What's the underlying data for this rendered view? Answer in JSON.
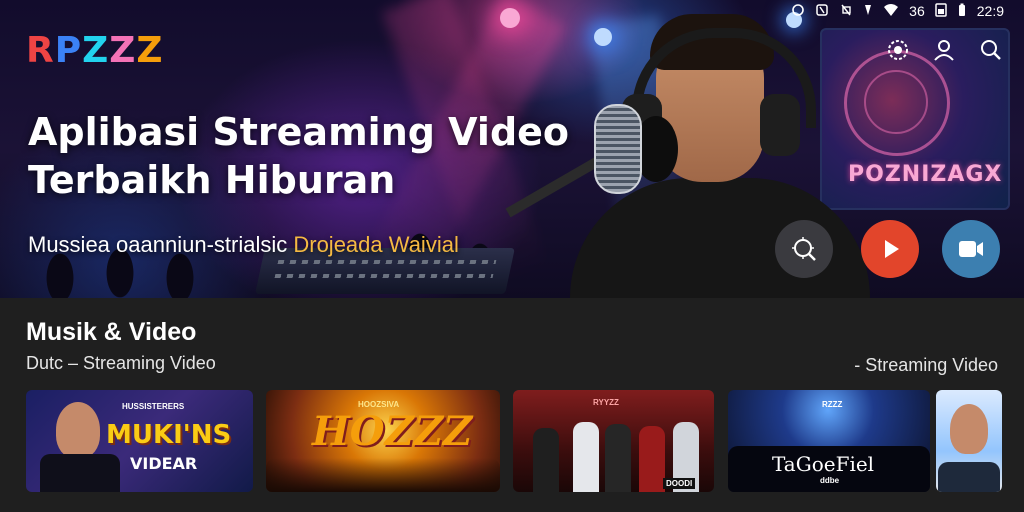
{
  "app": {
    "logo_letters": [
      {
        "char": "R",
        "color": "#ef4444"
      },
      {
        "char": "P",
        "color": "#3b82f6"
      },
      {
        "char": "Z",
        "color": "#22d3ee"
      },
      {
        "char": "Z",
        "color": "#f472b6"
      },
      {
        "char": "Z",
        "color": "#f59e0b"
      }
    ]
  },
  "status_bar": {
    "icons": [
      "alarm-icon",
      "nfc-icon",
      "mute-icon",
      "wifi-icon",
      "signal-icon"
    ],
    "battery": "36",
    "time": "22:9"
  },
  "top_actions": [
    "cast-icon",
    "profile-icon",
    "search-icon"
  ],
  "hero": {
    "title_line1": "Aplibasi Streaming Video",
    "title_line2": "Terbaikh Hiburan",
    "subtitle": "Mussiea oaanniun-strialsic",
    "subtitle_accent": "Drojeada Waivial",
    "screen_text": "POZNIZAGX",
    "actions": [
      "explore-icon",
      "play-icon",
      "video-camera-icon"
    ]
  },
  "section": {
    "title": "Musik & Video",
    "subtitle": "Dutc – Streaming Video",
    "link": "- Streaming Video"
  },
  "cards": [
    {
      "tag": "HUSSISTERERS",
      "title": "MUKI'NS",
      "title2": "VIDEAR"
    },
    {
      "tag": "HOOZSIVA",
      "title": "HOZZZ"
    },
    {
      "tag": "RYYZZ",
      "badge": "DOODI"
    },
    {
      "tag": "RZZZ",
      "title": "TaGoeFiel",
      "title2": "ddbe"
    },
    {}
  ],
  "colors": {
    "accent_yellow": "#f5b942",
    "play_red": "#e2452b",
    "video_blue": "#3c7fb0",
    "background": "#1f1f1f"
  }
}
